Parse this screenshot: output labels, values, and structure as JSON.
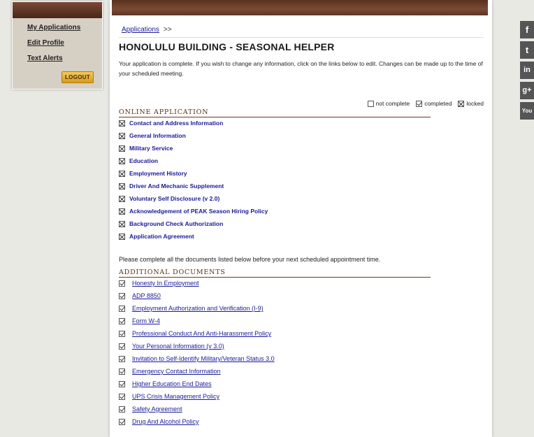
{
  "sidebar": {
    "links": [
      "My Applications",
      "Edit Profile",
      "Text Alerts"
    ],
    "logout_label": "LOGOUT"
  },
  "breadcrumb": {
    "link": "Applications",
    "separator": ">>"
  },
  "page_title": "HONOLULU BUILDING - SEASONAL HELPER",
  "intro_text": "Your application is complete. If you wish to change any information, click on the links below to edit. Changes can be made up to the time of your scheduled meeting.",
  "legend": {
    "not_complete": "not complete",
    "completed": "completed",
    "locked": "locked"
  },
  "online_application": {
    "heading": "ONLINE APPLICATION",
    "items": [
      "Contact and Address Information",
      "General Information",
      "Military Service",
      "Education",
      "Employment History",
      "Driver And Mechanic Supplement",
      "Voluntary Self Disclosure (v 2.0)",
      "Acknowledgement of PEAK Season Hiring Policy",
      "Background Check Authorization",
      "Application Agreement"
    ]
  },
  "documents_note": "Please complete all the documents listed below before your next scheduled appointment time.",
  "additional_documents": {
    "heading": "ADDITIONAL DOCUMENTS",
    "items": [
      "Honesty In Employment",
      "ADP 8850",
      "Employment Authorization and Verification (I-9)",
      "Form W-4",
      "Professional Conduct And Anti-Harassment Policy",
      "Your Personal Information (v 3.0)",
      "Invitation to Self-Identify Military/Veteran Status 3.0",
      "Emergency Contact Information",
      "Higher Education End Dates",
      "UPS Crisis Management Policy",
      "Safety Agreement",
      "Drug And Alcohol Policy"
    ]
  },
  "social": [
    {
      "icon": "facebook-icon",
      "glyph": "f"
    },
    {
      "icon": "twitter-icon",
      "glyph": "t"
    },
    {
      "icon": "linkedin-icon",
      "glyph": "in"
    },
    {
      "icon": "google-plus-icon",
      "glyph": "g+"
    },
    {
      "icon": "youtube-icon",
      "glyph": "You"
    }
  ]
}
